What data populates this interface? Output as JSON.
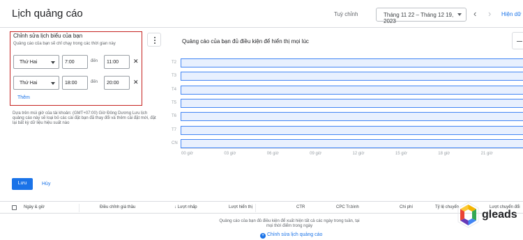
{
  "header": {
    "title": "Lịch quảng cáo",
    "custom_label": "Tuỳ chỉnh",
    "date_range": "Tháng 11 22 – Tháng 12 19, 2023",
    "show_link": "Hiện dữ liệ"
  },
  "edit_panel": {
    "title": "Chỉnh sửa lịch biểu của bạn",
    "description": "Quảng cáo của bạn sẽ chỉ chạy trong các thời gian này",
    "rows": [
      {
        "day": "Thứ Hai",
        "from": "7:00",
        "to_label": "đến",
        "to": "11:00"
      },
      {
        "day": "Thứ Hai",
        "from": "18:00",
        "to_label": "đến",
        "to": "20:00"
      }
    ],
    "add_label": "Thêm"
  },
  "timezone_note": "Dựa trên múi giờ của tài khoản: (GMT+07:00) Giờ Đông Dương Lưu lịch quảng cáo này sẽ loại bỏ các cài đặt bạn đã thay đổi và thêm cài đặt mới, đặt lại bất kỳ dữ liệu hiệu suất nào",
  "chart_data": {
    "type": "heatmap",
    "title": "Quảng cáo của bạn đủ điều kiện để hiển thị mọi lúc",
    "categories": [
      "T2",
      "T3",
      "T4",
      "T5",
      "T6",
      "T7",
      "CN"
    ],
    "x_ticks": [
      "00 giờ",
      "03 giờ",
      "06 giờ",
      "09 giờ",
      "12 giờ",
      "15 giờ",
      "18 giờ",
      "21 giờ"
    ],
    "xlim": [
      0,
      24
    ],
    "series": [
      {
        "day": "T2",
        "ranges": [
          [
            0,
            24
          ]
        ]
      },
      {
        "day": "T3",
        "ranges": [
          [
            0,
            24
          ]
        ]
      },
      {
        "day": "T4",
        "ranges": [
          [
            0,
            24
          ]
        ]
      },
      {
        "day": "T5",
        "ranges": [
          [
            0,
            24
          ]
        ]
      },
      {
        "day": "T6",
        "ranges": [
          [
            0,
            24
          ]
        ]
      },
      {
        "day": "T7",
        "ranges": [
          [
            0,
            24
          ]
        ]
      },
      {
        "day": "CN",
        "ranges": [
          [
            0,
            24
          ]
        ]
      }
    ],
    "fill_color": "#e8f0fe",
    "border_color": "#4285f4"
  },
  "actions": {
    "save": "Lưu",
    "cancel": "Hủy"
  },
  "table": {
    "columns": [
      "Ngày & giờ",
      "Điều chỉnh giá thầu",
      "Lượt nhấp",
      "Lượt hiển thị",
      "CTR",
      "CPC Tr.bình",
      "Chi phí",
      "Tỷ lệ chuyển",
      "Lượt chuyển đổi"
    ],
    "empty_note": "Quảng cáo của bạn đủ điều kiện để xuất hiện tất cả các ngày trong tuần, tại mọi thời điểm trong ngày",
    "edit_link": "Chỉnh sửa lịch quảng cáo"
  },
  "watermark": {
    "text": "gleads"
  },
  "colors": {
    "accent": "#1a73e8",
    "highlight_border": "#c5221f"
  }
}
